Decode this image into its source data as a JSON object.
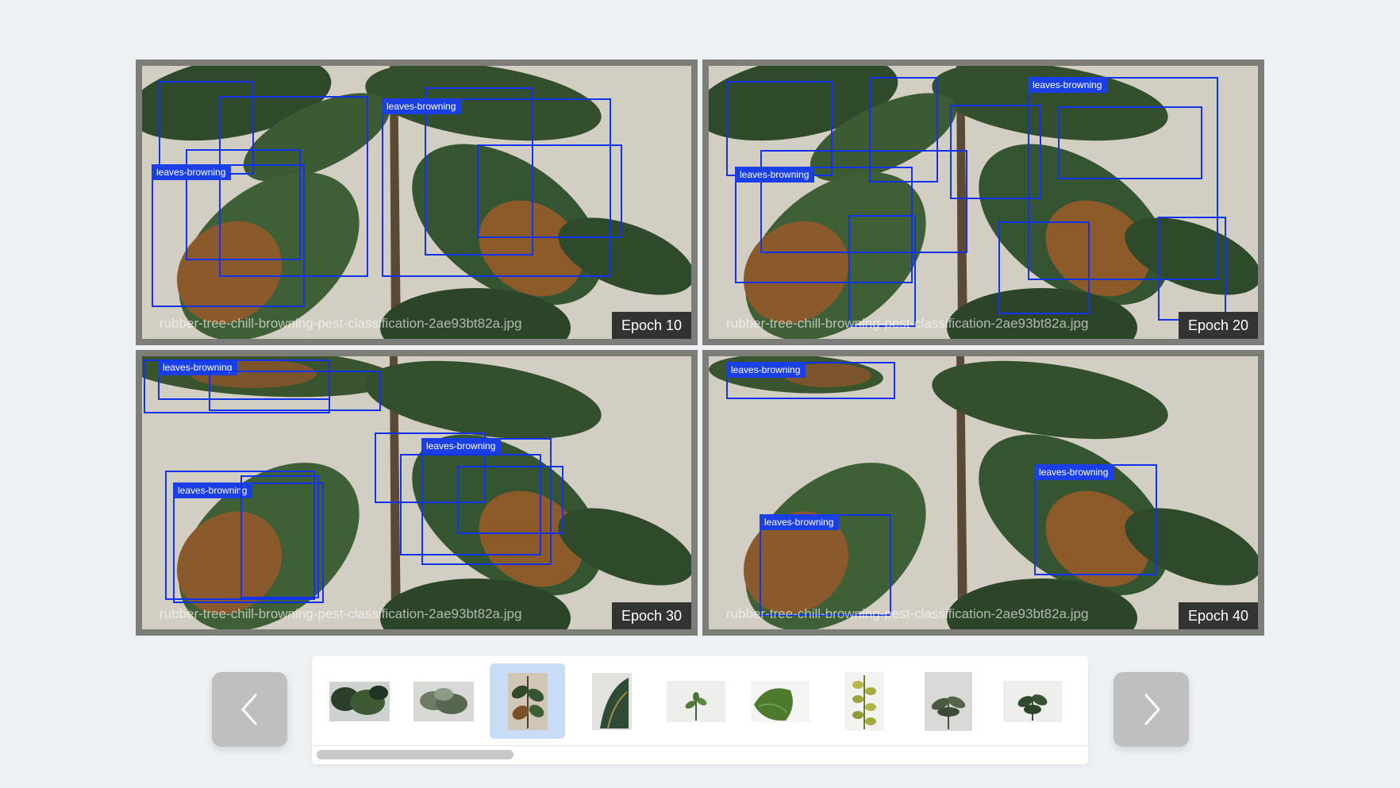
{
  "panels": [
    {
      "filename": "rubber-tree-chill-browning-pest-classification-2ae93bt82a.jpg",
      "epoch": "Epoch 10",
      "label": "leaves-browning"
    },
    {
      "filename": "rubber-tree-chill-browning-pest-classification-2ae93bt82a.jpg",
      "epoch": "Epoch 20",
      "label": "leaves-browning"
    },
    {
      "filename": "rubber-tree-chill-browning-pest-classification-2ae93bt82a.jpg",
      "epoch": "Epoch 30",
      "label": "leaves-browning"
    },
    {
      "filename": "rubber-tree-chill-browning-pest-classification-2ae93bt82a.jpg",
      "epoch": "Epoch 40",
      "label": "leaves-browning"
    }
  ],
  "colors": {
    "bbox": "#1433ee",
    "label_bg": "#1a3fe6",
    "selected_thumb": "#c9dcf5"
  },
  "icons": {
    "prev": "chevron-left-icon",
    "next": "chevron-right-icon"
  }
}
